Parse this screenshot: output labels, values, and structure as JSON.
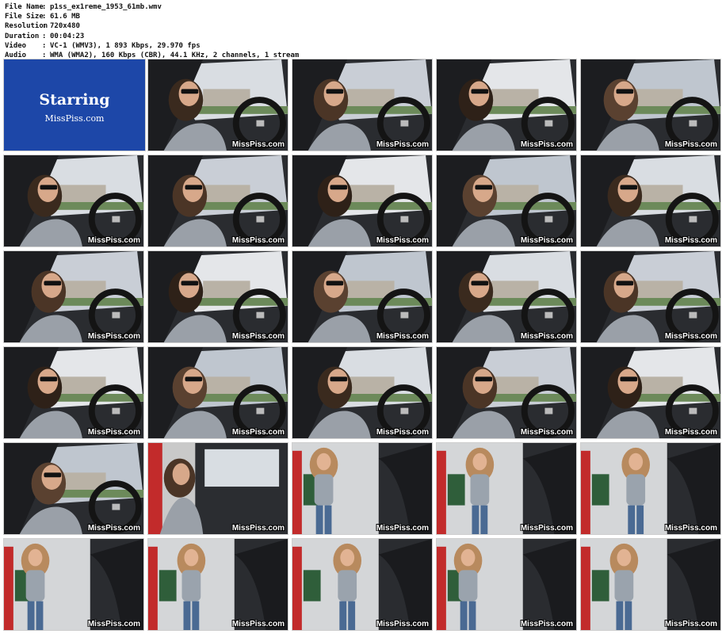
{
  "info": [
    {
      "key": "File Name",
      "value": "p1ss_ex1reme_1953_61mb.wmv"
    },
    {
      "key": "File Size",
      "value": "61.6 MB"
    },
    {
      "key": "Resolution",
      "value": "720x480"
    },
    {
      "key": "Duration",
      "value": "00:04:23"
    },
    {
      "key": "Video",
      "value": "VC-1 (WMV3), 1 893 Kbps, 29.970 fps"
    },
    {
      "key": "Audio",
      "value": "WMA (WMA2), 160 Kbps (CBR), 44.1 KHz, 2 channels, 1 stream"
    }
  ],
  "intro": {
    "title": "Starring",
    "subtitle": "MissPiss.com"
  },
  "watermark": "MissPiss.com",
  "colors": {
    "intro_bg": "#1d47a8",
    "text": "#111111",
    "watermark": "#ffffff"
  },
  "scenes": [
    "car-driving",
    "car-driving",
    "car-driving",
    "car-driving",
    "car-driving",
    "car-driving",
    "car-driving",
    "car-driving",
    "car-driving",
    "car-driving",
    "car-driving",
    "car-driving",
    "car-driving",
    "car-driving",
    "car-driving",
    "car-driving",
    "car-driving",
    "car-driving",
    "car-driving",
    "car-driving",
    "car-door-open",
    "gas-station",
    "gas-station",
    "gas-station",
    "gas-station",
    "gas-station",
    "gas-station",
    "gas-station",
    "gas-station"
  ]
}
